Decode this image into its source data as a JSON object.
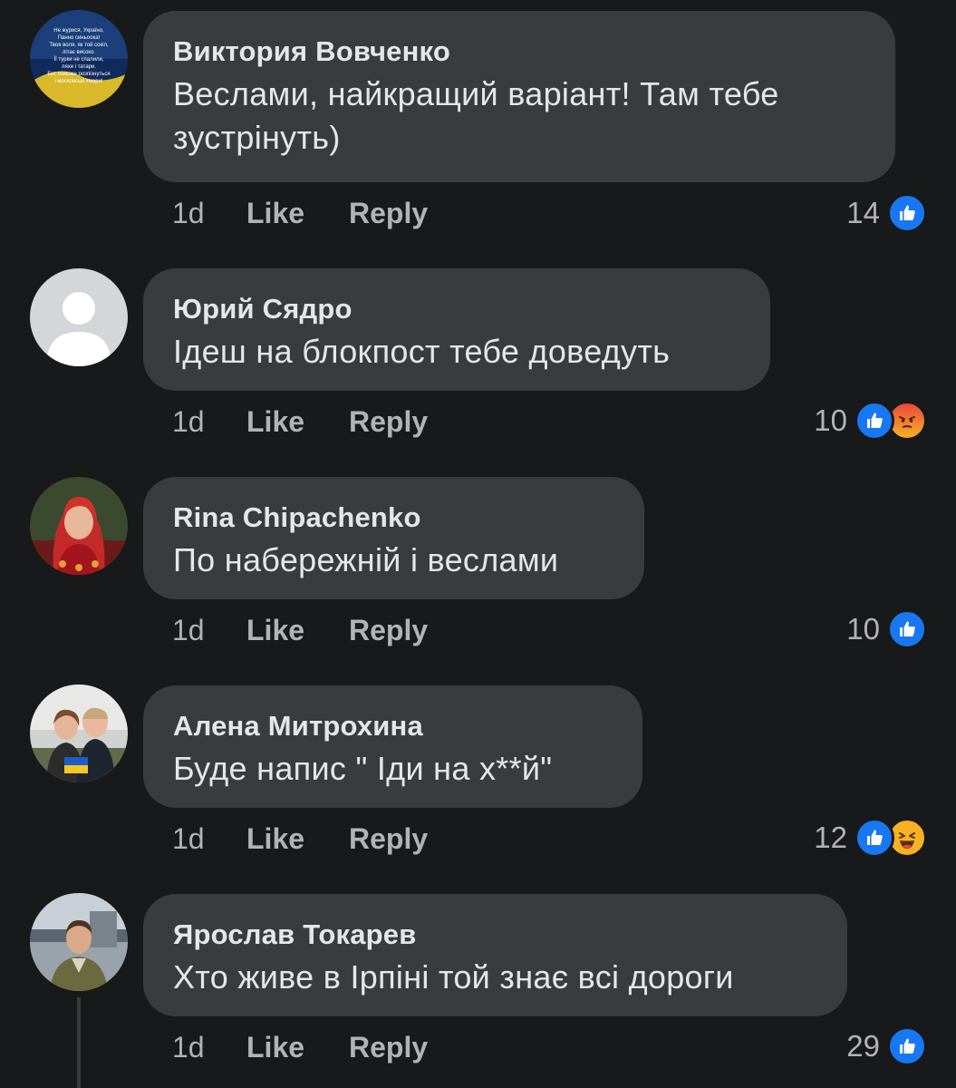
{
  "comments": [
    {
      "author": "Виктория Вовченко",
      "text_line1": "Веслами, найкращий варіант! Там тебе",
      "text_line2": "зустрінуть)",
      "time": "1d",
      "like_label": "Like",
      "reply_label": "Reply",
      "reaction_count": "14",
      "reactions": [
        "like-icon"
      ],
      "avatar_text": "Не журися, Україно, Панно синьоока! Твоя воля, як той сокіл, літає високо. Її турки не спалили, ляхи і татари. Бог поможе розпізнуться і московські хмари!"
    },
    {
      "author": "Юрий Сядро",
      "text": "Ідеш на блокпост тебе доведуть",
      "time": "1d",
      "like_label": "Like",
      "reply_label": "Reply",
      "reaction_count": "10",
      "reactions": [
        "like-icon",
        "angry-icon"
      ]
    },
    {
      "author": "Rina Chipachenko",
      "text": "По набережній і веслами",
      "time": "1d",
      "like_label": "Like",
      "reply_label": "Reply",
      "reaction_count": "10",
      "reactions": [
        "like-icon"
      ]
    },
    {
      "author": "Алена Митрохина",
      "text": "Буде напис \" Іди на х**й\"",
      "time": "1d",
      "like_label": "Like",
      "reply_label": "Reply",
      "reaction_count": "12",
      "reactions": [
        "like-icon",
        "haha-icon"
      ]
    },
    {
      "author": "Ярослав Токарев",
      "text": "Хто живе в Ірпіні той знає всі дороги",
      "time": "1d",
      "like_label": "Like",
      "reply_label": "Reply",
      "reaction_count": "29",
      "reactions": [
        "like-icon"
      ]
    }
  ],
  "colors": {
    "background": "#18191a",
    "bubble": "#3a3b3c",
    "text": "#e4e6eb",
    "secondary": "#b0b3b8",
    "like_blue": "#1877f2"
  }
}
